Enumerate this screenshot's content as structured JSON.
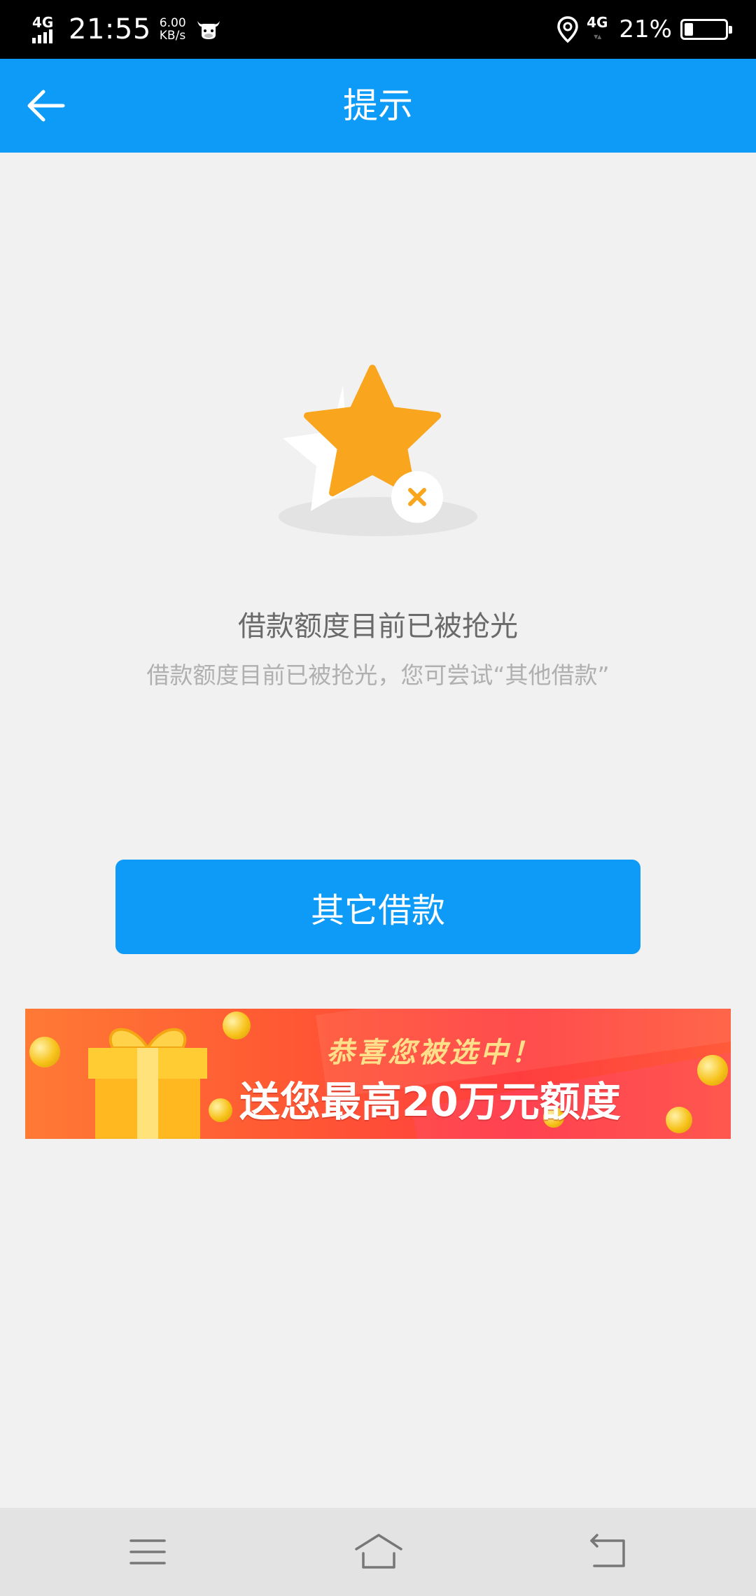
{
  "status_bar": {
    "network": "4G",
    "time": "21:55",
    "speed_value": "6.00",
    "speed_unit": "KB/s",
    "network_right": "4G",
    "battery": "21%"
  },
  "header": {
    "title": "提示"
  },
  "content": {
    "title": "借款额度目前已被抢光",
    "subtitle": "借款额度目前已被抢光，您可尝试“其他借款”",
    "button_label": "其它借款"
  },
  "banner": {
    "line1": "恭喜您被选中！",
    "line2": "送您最高20万元额度"
  },
  "colors": {
    "primary": "#0d9bf7",
    "star": "#f9a51e",
    "banner_red": "#ff4a3a"
  }
}
